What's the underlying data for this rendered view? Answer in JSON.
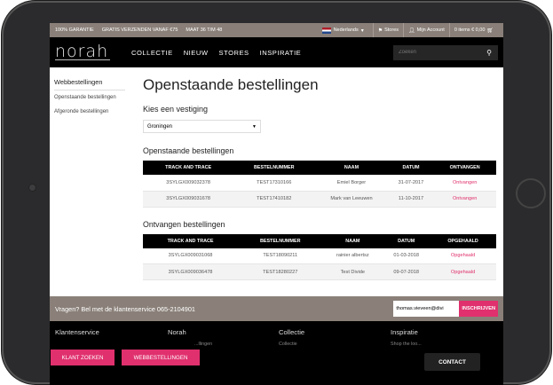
{
  "topbar": {
    "usps": [
      "100% GARANTIE",
      "GRATIS VERZENDEN VANAF €75",
      "MAAT 36 T/M 48"
    ],
    "language": "Nederlands",
    "stores": "Stores",
    "account": "Mijn Account",
    "cart": "0 items € 0,00"
  },
  "header": {
    "logo": "norah",
    "nav": [
      "COLLECTIE",
      "NIEUW",
      "STORES",
      "INSPIRATIE"
    ],
    "search_placeholder": "Zoeken"
  },
  "sidebar": {
    "title": "Webbestellingen",
    "items": [
      "Openstaande bestellingen",
      "Afgeronde bestellingen"
    ]
  },
  "main": {
    "title": "Openstaande bestellingen",
    "store_label": "Kies een vestiging",
    "store_value": "Groningen",
    "open_title": "Openstaande bestellingen",
    "open_headers": [
      "TRACK AND TRACE",
      "BESTELNUMMER",
      "NAAM",
      "DATUM",
      "ONTVANGEN"
    ],
    "open_rows": [
      [
        "3SYLGX009032378",
        "TEST17310166",
        "Emiel Borger",
        "31-07-2017",
        "Ontvangen"
      ],
      [
        "3SYLGX009031678",
        "TEST17410182",
        "Mark van Leeuwen",
        "11-10-2017",
        "Ontvangen"
      ]
    ],
    "received_title": "Ontvangen bestellingen",
    "received_headers": [
      "TRACK AND TRACE",
      "BESTELNUMMER",
      "NAAM",
      "DATUM",
      "OPGEHAALD"
    ],
    "received_rows": [
      [
        "3SYLGX009031068",
        "TEST18090211",
        "rainier albertsz",
        "01-03-2018",
        "Opgehaald"
      ],
      [
        "3SYLGX009036478",
        "TEST18280227",
        "Test Divide",
        "09-07-2018",
        "Opgehaald"
      ]
    ]
  },
  "newsletter": {
    "text": "Vragen? Bel met de klantenservice 065-2104901",
    "email_value": "thomas.vieveen@divi",
    "button": "INSCHRIJVEN"
  },
  "footer": {
    "columns": [
      {
        "title": "Klantenservice",
        "sub": ""
      },
      {
        "title": "Norah",
        "sub": "...llingen"
      },
      {
        "title": "Collectie",
        "sub": "Collectie"
      },
      {
        "title": "Inspiratie",
        "sub": "Shop the loo..."
      }
    ],
    "klant_zoeken": "KLANT ZOEKEN",
    "webbestellingen": "WEBBESTELLINGEN",
    "contact": "CONTACT"
  },
  "colors": {
    "accent": "#e0306d",
    "taupe": "#8a8079",
    "black": "#000000"
  }
}
